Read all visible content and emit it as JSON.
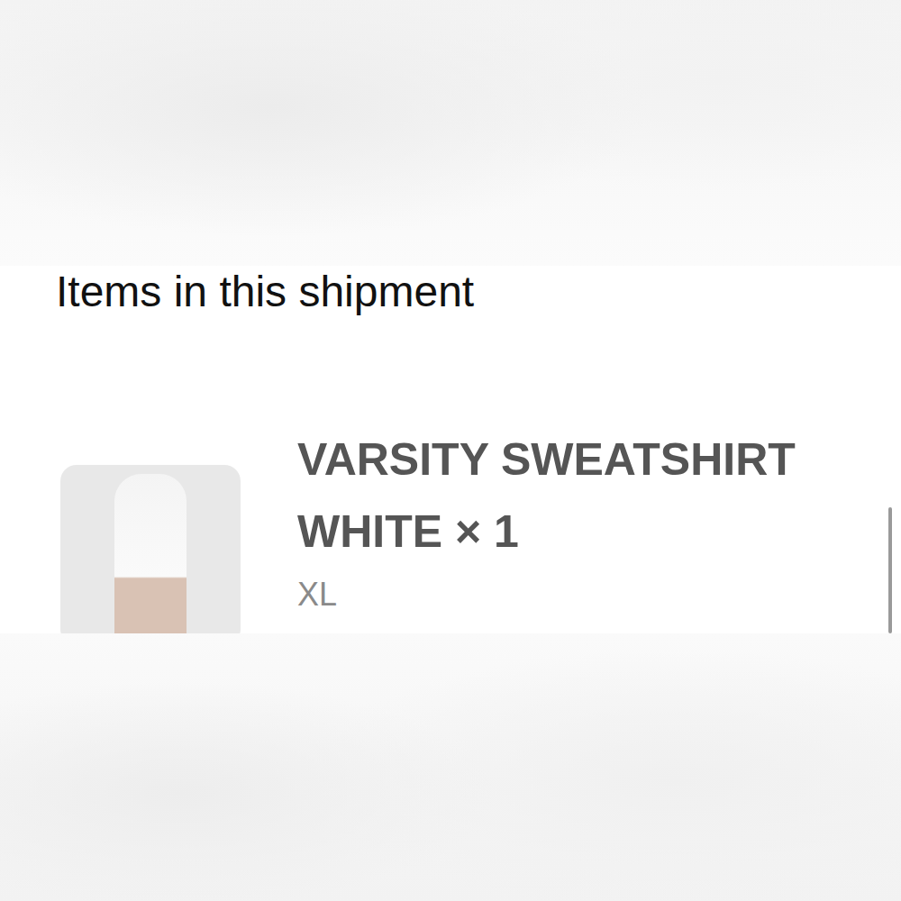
{
  "heading": "Items in this shipment",
  "items": [
    {
      "name": "VARSITY SWEATSHIRT",
      "variant": "WHITE × 1",
      "size": "XL"
    }
  ]
}
